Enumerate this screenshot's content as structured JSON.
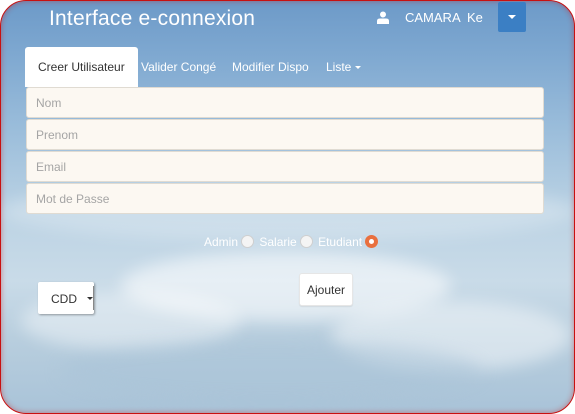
{
  "navbar": {
    "brand": "Interface e-connexion",
    "user_icon": "user-icon",
    "user_name": "CAMARA",
    "user_short": "Ke",
    "dropdown_icon": "caret-down-icon"
  },
  "tabs": [
    {
      "label": "Creer Utilisateur",
      "active": true
    },
    {
      "label": "Valider Congé",
      "active": false
    },
    {
      "label": "Modifier Dispo",
      "active": false
    },
    {
      "label": "Liste",
      "active": false,
      "has_dropdown": true
    }
  ],
  "form": {
    "fields": [
      {
        "placeholder": "Nom",
        "value": ""
      },
      {
        "placeholder": "Prenom",
        "value": ""
      },
      {
        "placeholder": "Email",
        "value": ""
      },
      {
        "placeholder": "Mot de Passe",
        "value": ""
      }
    ],
    "roles": [
      {
        "label": "Admin",
        "checked": false
      },
      {
        "label": "Salarie",
        "checked": false
      },
      {
        "label": "Etudiant",
        "checked": true
      }
    ],
    "contract_select": {
      "selected": "CDD"
    },
    "submit_label": "Ajouter"
  },
  "colors": {
    "accent": "#3b7fc4",
    "radio_checked": "#e9703f",
    "frame_border": "#c81010"
  }
}
